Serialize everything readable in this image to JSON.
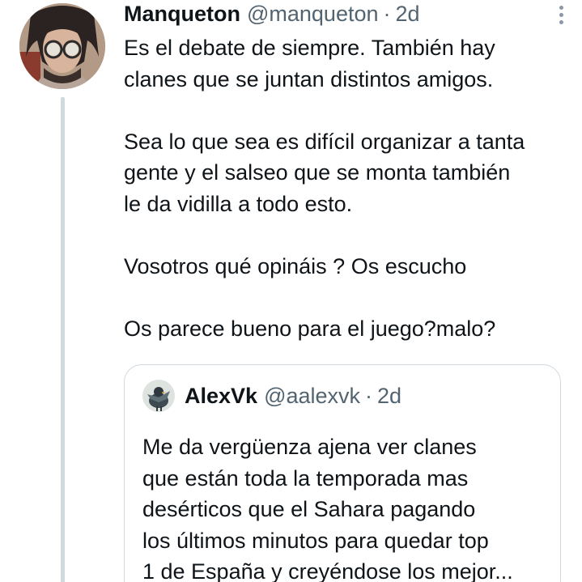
{
  "tweet": {
    "author": {
      "name": "Manqueton",
      "handle": "@manqueton",
      "separator": "·",
      "time": "2d"
    },
    "paragraphs": [
      [
        "Es el debate de siempre. También hay",
        "clanes que se juntan distintos amigos."
      ],
      [
        "Sea lo que sea es difícil organizar a tanta",
        "gente y el salseo que se monta también",
        "le da vidilla a todo esto."
      ],
      [
        "Vosotros qué opináis ? Os escucho"
      ],
      [
        "Os parece bueno para el juego?malo?"
      ]
    ]
  },
  "quoted_tweet": {
    "author": {
      "name": "AlexVk",
      "handle": "@aalexvk",
      "separator": "·",
      "time": "2d"
    },
    "lines": [
      "Me da vergüenza ajena ver clanes",
      "que están toda la temporada mas",
      "desérticos que el Sahara pagando",
      "los últimos minutos para quedar top",
      "1 de España y creyéndose los mejor..."
    ]
  },
  "icons": {
    "avatar": "cartoon-avatar-with-glasses",
    "more": "more-vertical-icon",
    "quoted_avatar": "bird-avatar"
  },
  "colors": {
    "text": "#0f1419",
    "secondary": "#536471",
    "thread_line": "#cfd9de",
    "quote_border": "#cfd9de"
  }
}
